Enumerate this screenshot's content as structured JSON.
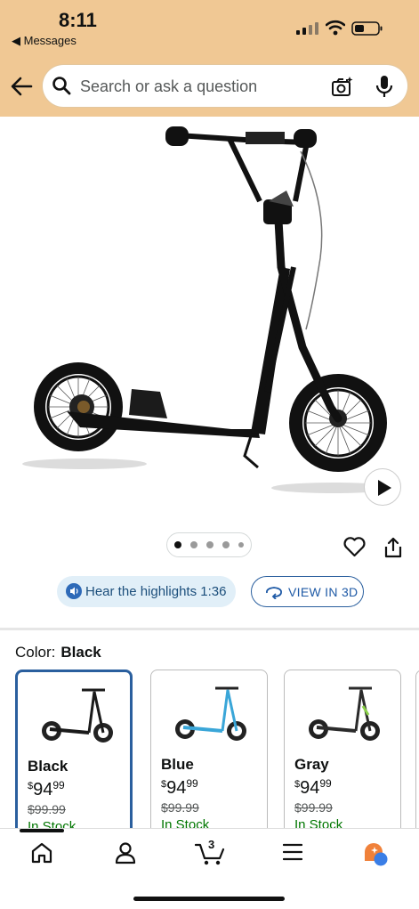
{
  "status_bar": {
    "time": "8:11",
    "back_app": "◀ Messages"
  },
  "search": {
    "placeholder": "Search or ask a question"
  },
  "actions": {
    "highlights_label": "Hear the highlights 1:36",
    "view_3d_label": "VIEW IN 3D"
  },
  "gallery": {
    "image_count": 5,
    "current_index": 0
  },
  "color": {
    "label": "Color:",
    "selected": "Black"
  },
  "variants": [
    {
      "name": "Black",
      "currency": "$",
      "price_whole": "94",
      "price_cents": "99",
      "list_price": "$99.99",
      "availability": "In Stock",
      "frame_color": "#1a1a1a"
    },
    {
      "name": "Blue",
      "currency": "$",
      "price_whole": "94",
      "price_cents": "99",
      "list_price": "$99.99",
      "availability": "In Stock",
      "frame_color": "#3aa6d8"
    },
    {
      "name": "Gray",
      "currency": "$",
      "price_whole": "94",
      "price_cents": "99",
      "list_price": "$99.99",
      "availability": "In Stock",
      "frame_color": "#2b2b2b"
    }
  ],
  "nav": {
    "cart_count": "3"
  },
  "colors": {
    "header_bg": "#f0c894",
    "accent_blue": "#2a5f9e",
    "in_stock_green": "#007600"
  }
}
